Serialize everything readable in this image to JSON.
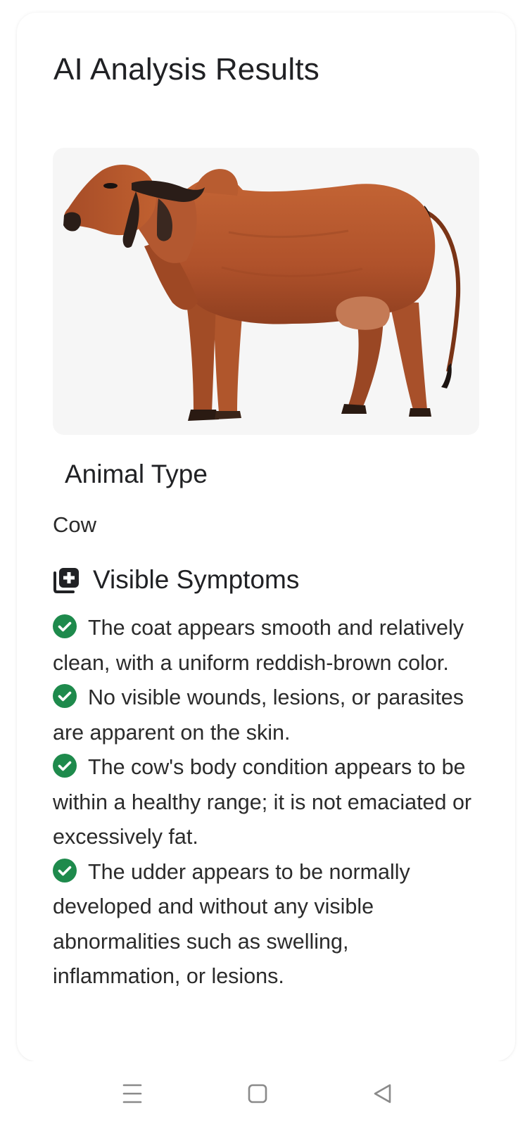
{
  "page": {
    "title": "AI Analysis Results"
  },
  "image": {
    "subject": "cow-photo"
  },
  "animal_type": {
    "label": "Animal Type",
    "value": "Cow"
  },
  "symptoms": {
    "label": "Visible Symptoms",
    "icon": "medical-add-icon",
    "items": [
      "The coat appears smooth and relatively clean, with a uniform reddish-brown color.",
      "No visible wounds, lesions, or parasites are apparent on the skin.",
      "The cow's body condition appears to be within a healthy range; it is not emaciated or excessively fat.",
      "The udder appears to be normally developed and without any visible abnormalities such as swelling, inflammation, or lesions."
    ]
  },
  "nav": {
    "menu_icon": "menu-icon",
    "home_icon": "home-square-icon",
    "back_icon": "back-triangle-icon"
  },
  "colors": {
    "check": "#1e8a4c",
    "text": "#202124",
    "image_bg": "#f6f6f6",
    "cow_body": "#b5562e"
  }
}
